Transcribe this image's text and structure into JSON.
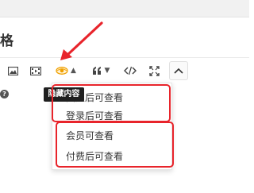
{
  "header": {
    "title": "格"
  },
  "toolbar": {
    "image_icon": "image-icon",
    "video_icon": "video-icon",
    "hide_icon": "eye-hide-icon",
    "quote_icon": "quote-icon",
    "code_icon": "code-icon",
    "fullscreen_icon": "fullscreen-icon",
    "collapse_icon": "chevron-up-icon",
    "caret": "▲",
    "quote_caret": "▼"
  },
  "tooltip": {
    "text": "隐藏内容"
  },
  "help": {
    "symbol": "?"
  },
  "dropdown": {
    "items": [
      {
        "label": "回复后可查看"
      },
      {
        "label": "登录后可查看"
      },
      {
        "label": "会员可查看"
      },
      {
        "label": "付费后可查看"
      }
    ]
  },
  "colors": {
    "highlight": "#e8242b",
    "hide_icon_accent": "#f0a000",
    "text": "#333333"
  }
}
